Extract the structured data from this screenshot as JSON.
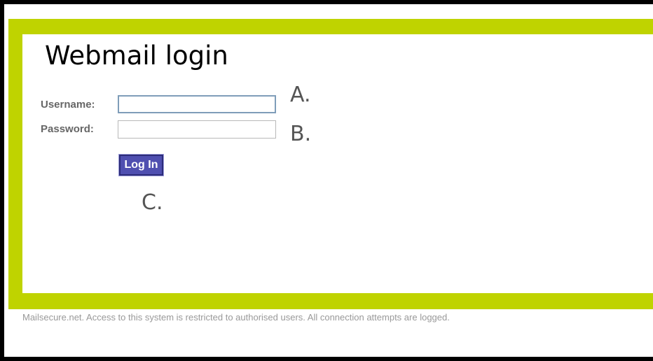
{
  "login": {
    "title": "Webmail login",
    "username_label": "Username:",
    "username_value": "",
    "password_label": "Password:",
    "password_value": "",
    "submit_label": "Log In"
  },
  "annotations": {
    "a": "A.",
    "b": "B.",
    "c": "C."
  },
  "footer": {
    "notice": "Mailsecure.net. Access to this system is restricted to authorised users. All connection attempts are logged."
  },
  "colors": {
    "accent_green": "#bfd300",
    "button_blue": "#4f4fb0",
    "label_gray": "#666666",
    "footer_gray": "#999999"
  }
}
